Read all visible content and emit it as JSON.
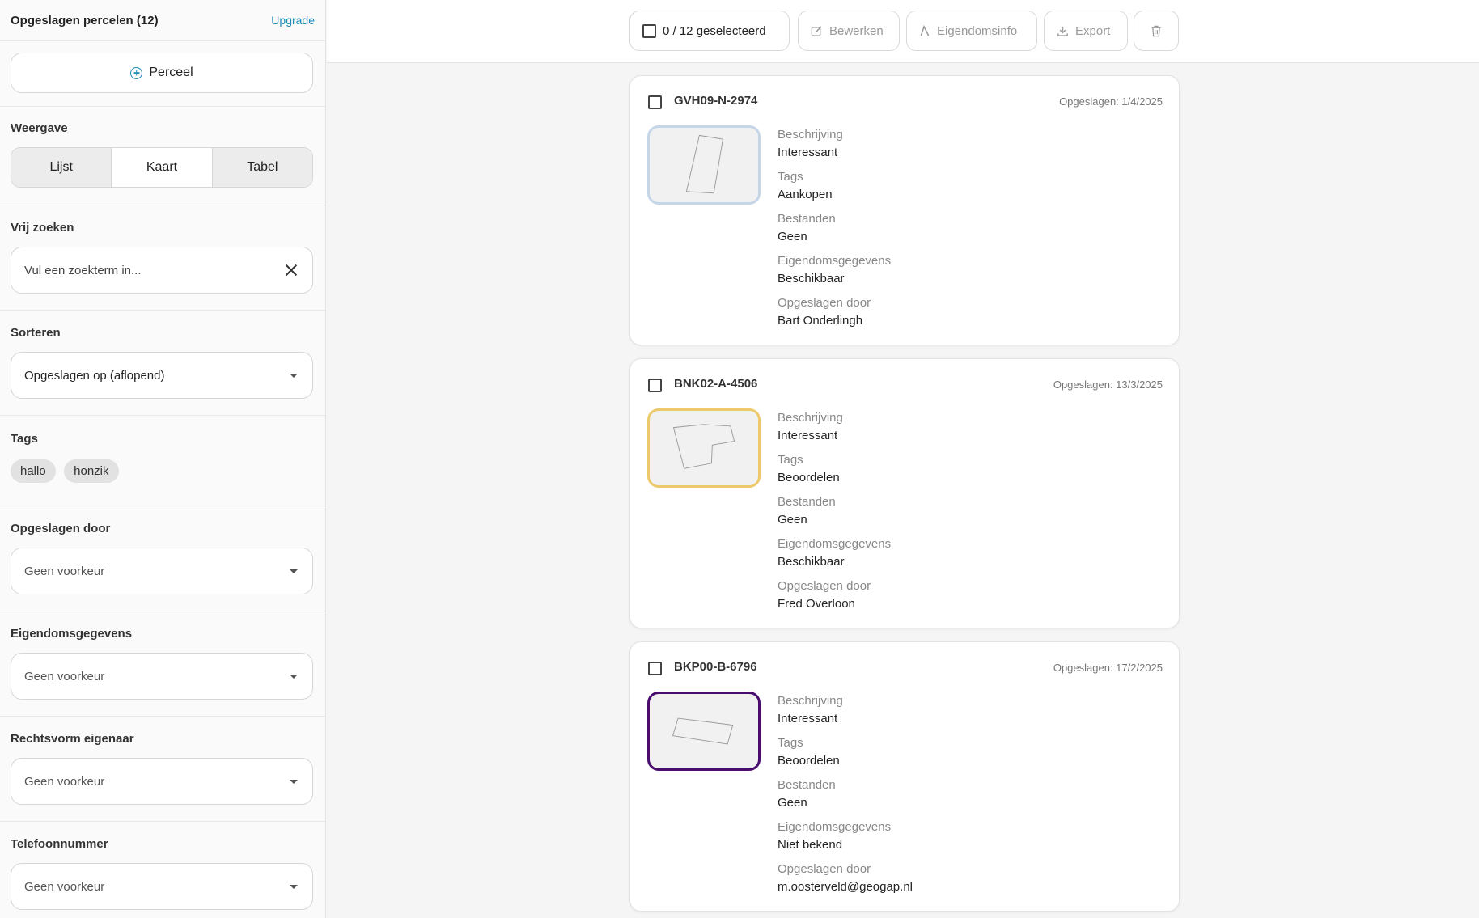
{
  "sidebar": {
    "title": "Opgeslagen percelen (12)",
    "upgrade": "Upgrade",
    "add_button": "Perceel",
    "view": {
      "label": "Weergave",
      "options": [
        "Lijst",
        "Kaart",
        "Tabel"
      ],
      "active": "Kaart"
    },
    "search": {
      "label": "Vrij zoeken",
      "placeholder": "Vul een zoekterm in...",
      "value": ""
    },
    "sort": {
      "label": "Sorteren",
      "value": "Opgeslagen op (aflopend)"
    },
    "tags": {
      "label": "Tags",
      "items": [
        "hallo",
        "honzik"
      ]
    },
    "filters": [
      {
        "label": "Opgeslagen door",
        "value": "Geen voorkeur"
      },
      {
        "label": "Eigendomsgegevens",
        "value": "Geen voorkeur"
      },
      {
        "label": "Rechtsvorm eigenaar",
        "value": "Geen voorkeur"
      },
      {
        "label": "Telefoonnummer",
        "value": "Geen voorkeur"
      }
    ]
  },
  "toolbar": {
    "selection": "0 / 12 geselecteerd",
    "edit": "Bewerken",
    "ownership": "Eigendomsinfo",
    "export": "Export",
    "icons": {
      "edit": "edit-icon",
      "ownership": "ownership-icon",
      "export": "download-icon",
      "delete": "trash-icon"
    }
  },
  "field_labels": {
    "description": "Beschrijving",
    "tags": "Tags",
    "files": "Bestanden",
    "ownership": "Eigendomsgegevens",
    "saved_by": "Opgeslagen door"
  },
  "parcels": [
    {
      "id": "GVH09-N-2974",
      "saved": "Opgeslagen: 1/4/2025",
      "description": "Interessant",
      "tags": "Aankopen",
      "files": "Geen",
      "ownership": "Beschikbaar",
      "saved_by": "Bart Onderlingh",
      "border_color": "#c4d6e8"
    },
    {
      "id": "BNK02-A-4506",
      "saved": "Opgeslagen: 13/3/2025",
      "description": "Interessant",
      "tags": "Beoordelen",
      "files": "Geen",
      "ownership": "Beschikbaar",
      "saved_by": "Fred Overloon",
      "border_color": "#ecc96a"
    },
    {
      "id": "BKP00-B-6796",
      "saved": "Opgeslagen: 17/2/2025",
      "description": "Interessant",
      "tags": "Beoordelen",
      "files": "Geen",
      "ownership": "Niet bekend",
      "saved_by": "m.oosterveld@geogap.nl",
      "border_color": "#4a0d6e"
    }
  ]
}
